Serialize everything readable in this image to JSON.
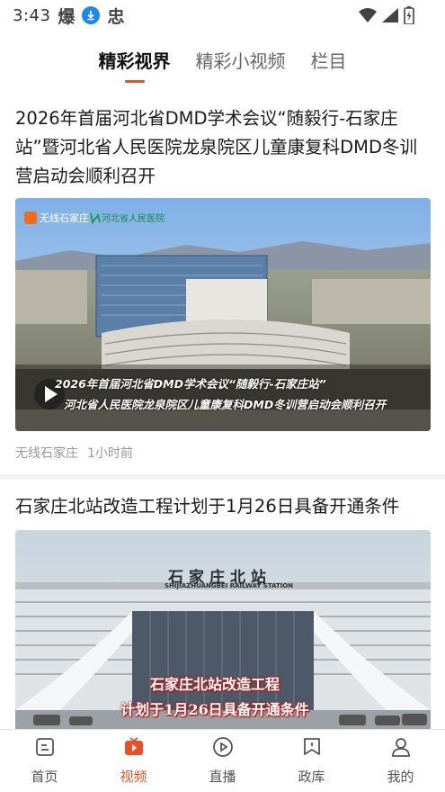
{
  "status_bar": {
    "time": "3:43",
    "glyph1": "爆",
    "glyph2": "忠",
    "icons": [
      "download-icon",
      "wifi-icon",
      "signal-icon",
      "battery-icon"
    ]
  },
  "tabs": [
    {
      "label": "精彩视界",
      "active": true
    },
    {
      "label": "精彩小视频",
      "active": false
    },
    {
      "label": "栏目",
      "active": false
    }
  ],
  "cards": [
    {
      "title": "2026年首届河北省DMD学术会议“随毅行-石家庄站”暨河北省人民医院龙泉院区儿童康复科DMD冬训营启动会顺利召开",
      "thumb_logo": "无线石家庄",
      "thumb_partner": "河北省人民医院",
      "overlay_line1": "2026年首届河北省DMD学术会议“随毅行-石家庄站”",
      "overlay_line2": "河北省人民医院龙泉院区儿童康复科DMD冬训营启动会顺利召开",
      "source": "无线石家庄",
      "time": "1小时前"
    },
    {
      "title": "石家庄北站改造工程计划于1月26日具备开通条件",
      "station_sign": "石家庄北站",
      "station_sign_en": "SHIJIAZHUANGBEI RAILWAY STATION",
      "overlay_line1": "石家庄北站改造工程",
      "overlay_line2": "计划于1月26日具备开通条件"
    }
  ],
  "bottom_nav": [
    {
      "label": "首页",
      "icon": "home-icon",
      "active": false
    },
    {
      "label": "视频",
      "icon": "video-icon",
      "active": true
    },
    {
      "label": "直播",
      "icon": "live-icon",
      "active": false
    },
    {
      "label": "政库",
      "icon": "bookmark-icon",
      "active": false
    },
    {
      "label": "我的",
      "icon": "profile-icon",
      "active": false
    }
  ],
  "colors": {
    "accent": "#e8502b",
    "download_badge": "#1e8ae6",
    "meta_text": "#999999"
  }
}
